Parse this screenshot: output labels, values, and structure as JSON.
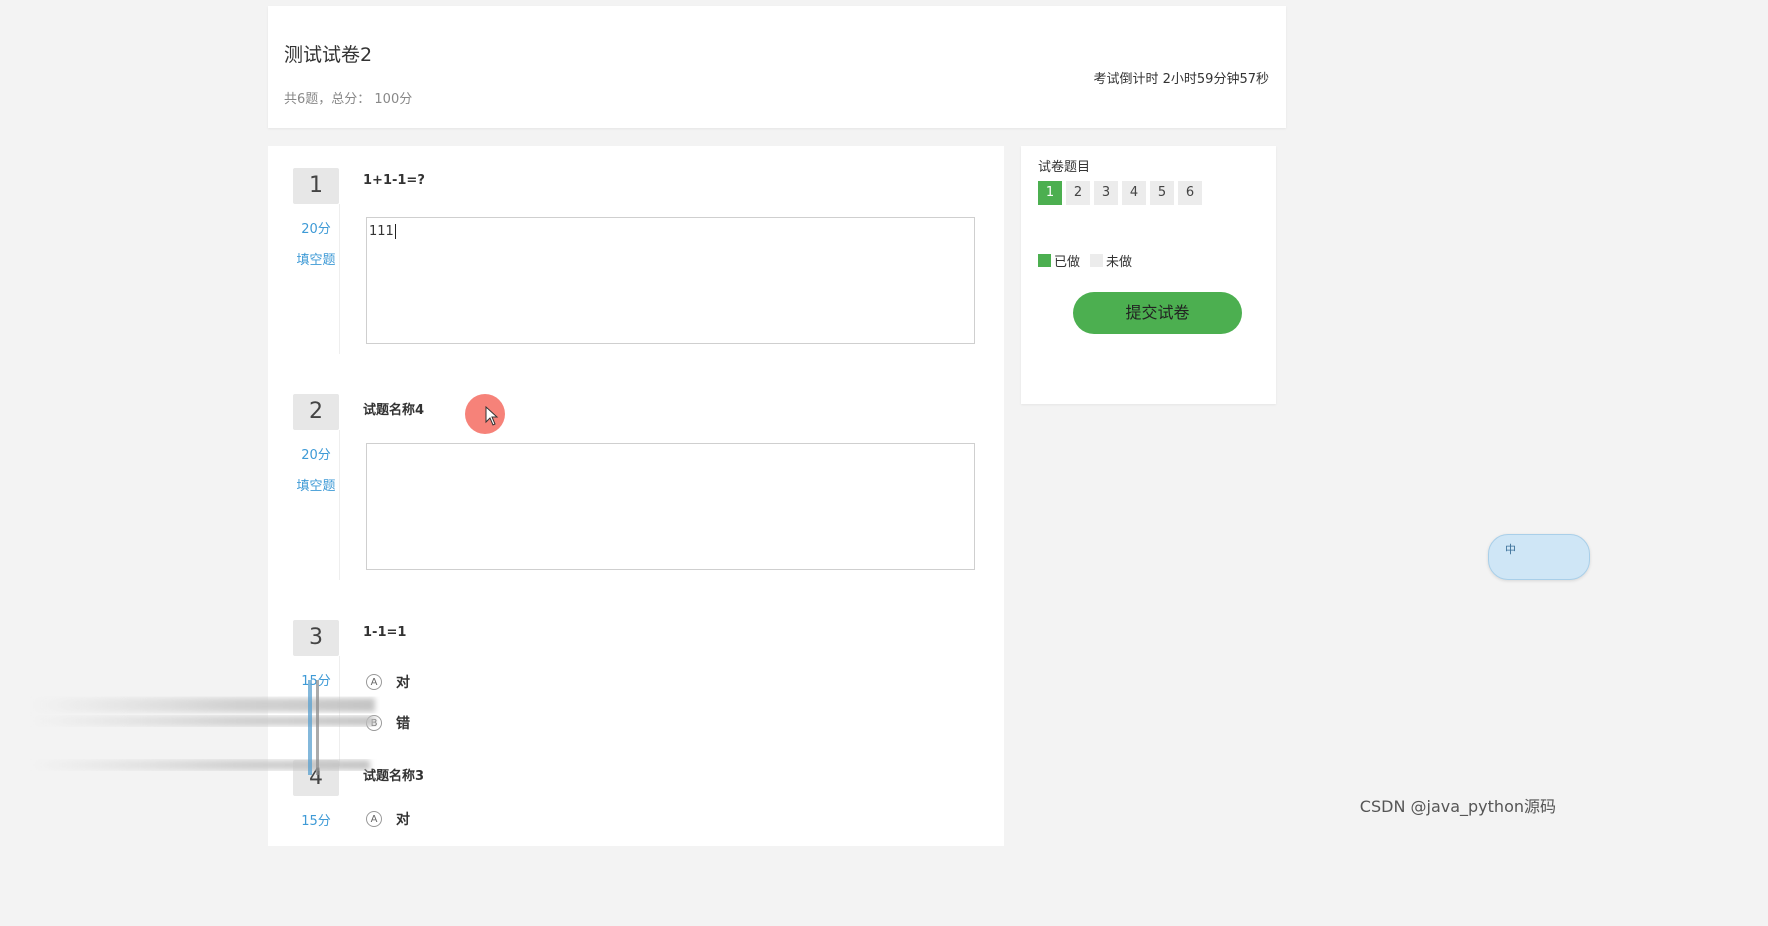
{
  "exam": {
    "title": "测试试卷2",
    "meta": "共6题，总分：  100分",
    "countdown": "考试倒计时 2小时59分钟57秒"
  },
  "questions": [
    {
      "number": "1",
      "score": "20分",
      "type": "填空题",
      "text": "1+1-1=?",
      "answer": "111"
    },
    {
      "number": "2",
      "score": "20分",
      "type": "填空题",
      "text": "试题名称4",
      "answer": ""
    },
    {
      "number": "3",
      "score": "15分",
      "type": "",
      "text": "1-1=1",
      "options": [
        {
          "letter": "A",
          "label": "对"
        },
        {
          "letter": "B",
          "label": "错"
        }
      ]
    },
    {
      "number": "4",
      "score": "15分",
      "type": "",
      "text": "试题名称3",
      "options": [
        {
          "letter": "A",
          "label": "对"
        }
      ]
    }
  ],
  "sidebar": {
    "title": "试卷题目",
    "nav": [
      "1",
      "2",
      "3",
      "4",
      "5",
      "6"
    ],
    "answered": [
      "1"
    ],
    "legend_done": "已做",
    "legend_todo": "未做",
    "submit_label": "提交试卷"
  },
  "ime": {
    "label": "中"
  },
  "watermark": "CSDN @java_python源码",
  "colors": {
    "accent_green": "#4caf50",
    "link_blue": "#3e9ad6",
    "nav_idle": "#ececec",
    "cursor_highlight": "#f56c62"
  }
}
